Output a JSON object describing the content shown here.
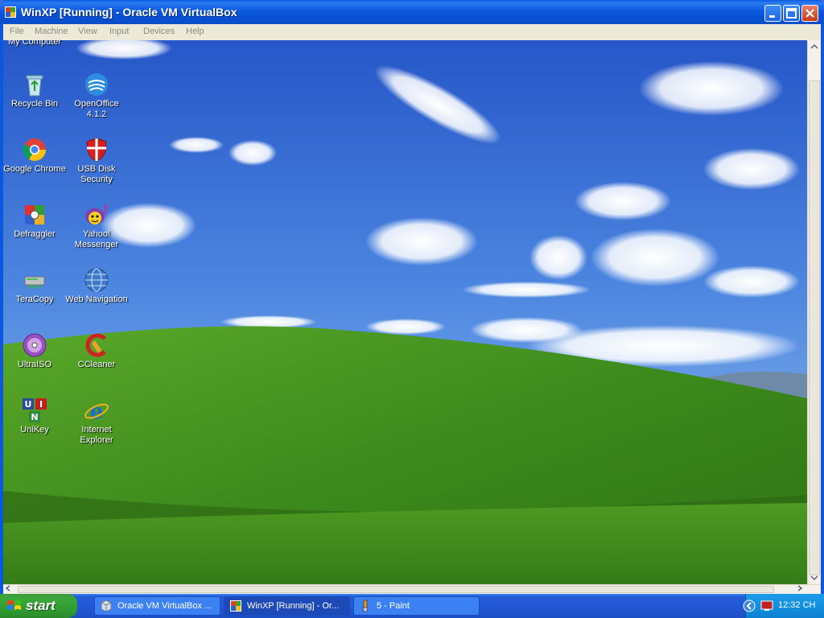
{
  "window": {
    "title": "WinXP [Running] - Oracle VM VirtualBox",
    "menu": [
      "File",
      "Machine",
      "View",
      "Input",
      "Devices",
      "Help"
    ]
  },
  "desktop": {
    "partial_icon_label": "My Computer",
    "icons": [
      {
        "label": "Recycle Bin",
        "icon": "recycle-bin-icon"
      },
      {
        "label": "OpenOffice 4.1.2",
        "icon": "openoffice-icon"
      },
      {
        "label": "Google Chrome",
        "icon": "chrome-icon"
      },
      {
        "label": "USB Disk Security",
        "icon": "usb-disk-security-icon"
      },
      {
        "label": "Defraggler",
        "icon": "defraggler-icon"
      },
      {
        "label": "Yahoo! Messenger",
        "icon": "yahoo-messenger-icon"
      },
      {
        "label": "TeraCopy",
        "icon": "teracopy-icon"
      },
      {
        "label": "Web Navigation",
        "icon": "web-navigation-icon"
      },
      {
        "label": "UltraISO",
        "icon": "ultraiso-icon"
      },
      {
        "label": "CCleaner",
        "icon": "ccleaner-icon"
      },
      {
        "label": "UniKey",
        "icon": "unikey-icon"
      },
      {
        "label": "Internet Explorer",
        "icon": "internet-explorer-icon"
      }
    ],
    "unikey_letters": [
      "U",
      "I",
      "N"
    ]
  },
  "taskbar": {
    "start_label": "start",
    "tasks": [
      {
        "label": "Oracle VM VirtualBox ...",
        "icon": "virtualbox-icon",
        "active": false
      },
      {
        "label": "WinXP [Running] - Or...",
        "icon": "virtualbox-vm-icon",
        "active": true
      },
      {
        "label": "5 - Paint",
        "icon": "paint-icon",
        "active": false
      }
    ],
    "clock": "12:32 CH"
  },
  "colors": {
    "title_blue": "#0b58de",
    "taskbar_blue": "#245edb",
    "start_green": "#3aa83a",
    "sky": "#3b6fd6",
    "grass": "#4e9a1e"
  }
}
